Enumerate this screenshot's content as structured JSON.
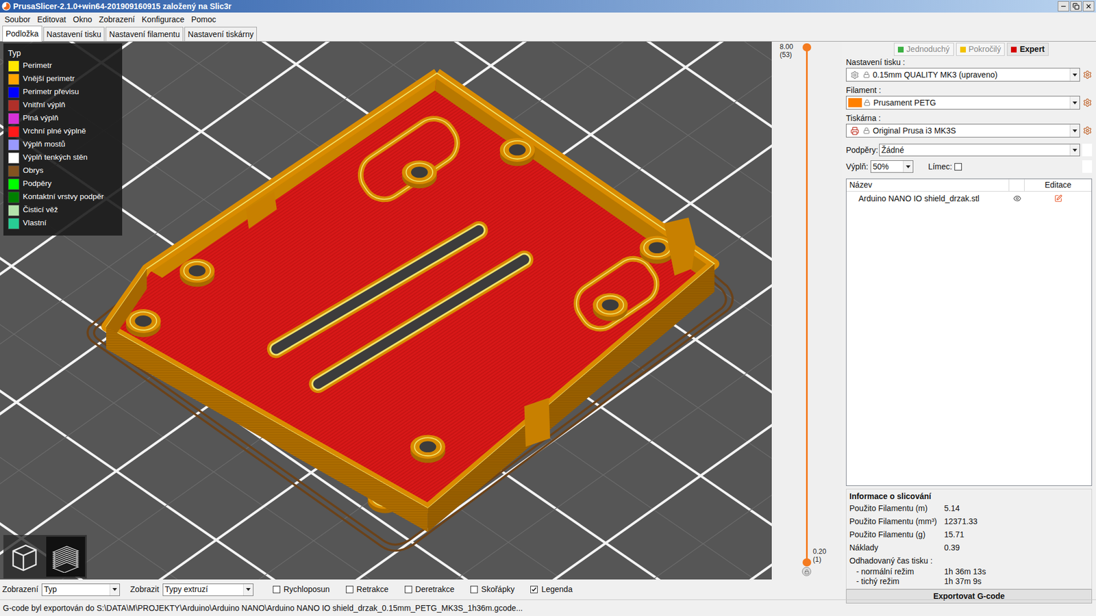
{
  "window": {
    "title": "PrusaSlicer-2.1.0+win64-201909160915 založený na Slic3r"
  },
  "menu": [
    "Soubor",
    "Editovat",
    "Okno",
    "Zobrazení",
    "Konfigurace",
    "Pomoc"
  ],
  "tabs": [
    {
      "label": "Podložka",
      "selected": true
    },
    {
      "label": "Nastavení tisku",
      "selected": false
    },
    {
      "label": "Nastavení filamentu",
      "selected": false
    },
    {
      "label": "Nastavení tiskárny",
      "selected": false
    }
  ],
  "legend": {
    "title": "Typ",
    "items": [
      {
        "label": "Perimetr",
        "color": "#ffe600"
      },
      {
        "label": "Vnější perimetr",
        "color": "#ffa500"
      },
      {
        "label": "Perimetr převisu",
        "color": "#0000ff"
      },
      {
        "label": "Vnitřní výplň",
        "color": "#b03029"
      },
      {
        "label": "Plná výplň",
        "color": "#d732d7"
      },
      {
        "label": "Vrchní plné výplně",
        "color": "#ff1a1a"
      },
      {
        "label": "Výplň mostů",
        "color": "#9999ff"
      },
      {
        "label": "Výplň tenkých stěn",
        "color": "#ffffff"
      },
      {
        "label": "Obrys",
        "color": "#845321"
      },
      {
        "label": "Podpěry",
        "color": "#00ff00"
      },
      {
        "label": "Kontaktní vrstvy podpěr",
        "color": "#008000"
      },
      {
        "label": "Čisticí věž",
        "color": "#b3e3ab"
      },
      {
        "label": "Vlastní",
        "color": "#28cc94"
      }
    ]
  },
  "view_modes": [
    {
      "kind": "3d",
      "selected": false
    },
    {
      "kind": "layers",
      "selected": true
    }
  ],
  "layer_slider": {
    "top": {
      "height": "8.00",
      "layer": "(53)",
      "level": 1
    },
    "bottom": {
      "height": "0.20",
      "layer": "(1)",
      "level": 0
    }
  },
  "modes": [
    {
      "label": "Jednoduchý",
      "color": "#3cb043",
      "selected": false
    },
    {
      "label": "Pokročilý",
      "color": "#f2c200",
      "selected": false
    },
    {
      "label": "Expert",
      "color": "#d40000",
      "selected": true
    }
  ],
  "presets": [
    {
      "label": "Nastavení tisku :",
      "value": "0.15mm QUALITY MK3 (upraveno)",
      "kind": "print"
    },
    {
      "label": "Filament :",
      "value": "Prusament PETG",
      "kind": "filament",
      "color": "#ff8000"
    },
    {
      "label": "Tiskárna :",
      "value": "Original Prusa i3 MK3S",
      "kind": "printer"
    }
  ],
  "supports": {
    "label": "Podpěry:",
    "value": "Žádné"
  },
  "infill": {
    "label": "Výplň:",
    "value": "50%"
  },
  "brim": {
    "label": "Límec:",
    "checked": false
  },
  "object_list": {
    "columns": [
      "Název",
      "Editace"
    ],
    "rows": [
      {
        "name": "Arduino NANO IO shield_drzak.stl",
        "visible": true
      }
    ]
  },
  "slicing_info": {
    "title": "Informace o slicování",
    "rows": [
      {
        "label": "Použito Filamentu (m)",
        "value": "5.14"
      },
      {
        "label": "Použito Filamentu (mm³)",
        "value": "12371.33"
      },
      {
        "label": "Použito Filamentu (g)",
        "value": "15.71"
      },
      {
        "label": "Náklady",
        "value": "0.39"
      }
    ],
    "time_label": "Odhadovaný čas tisku :",
    "time_rows": [
      {
        "label": "- normální režim",
        "value": "1h 36m 13s"
      },
      {
        "label": "- tichý režim",
        "value": "1h 37m 9s"
      }
    ]
  },
  "export_button": "Exportovat G-code",
  "toolbar": {
    "view_label": "Zobrazení",
    "view_value": "Typ",
    "show_label": "Zobrazit",
    "show_value": "Typy extruzí",
    "checkboxes": [
      {
        "label": "Rychloposun",
        "checked": false
      },
      {
        "label": "Retrakce",
        "checked": false
      },
      {
        "label": "Deretrakce",
        "checked": false
      },
      {
        "label": "Skořápky",
        "checked": false
      },
      {
        "label": "Legenda",
        "checked": true
      }
    ]
  },
  "status_bar": "G-code byl exportován do S:\\DATA\\M\\PROJEKTY\\Arduino\\Arduino NANO\\Arduino NANO IO shield_drzak_0.15mm_PETG_MK3S_1h36m.gcode..."
}
